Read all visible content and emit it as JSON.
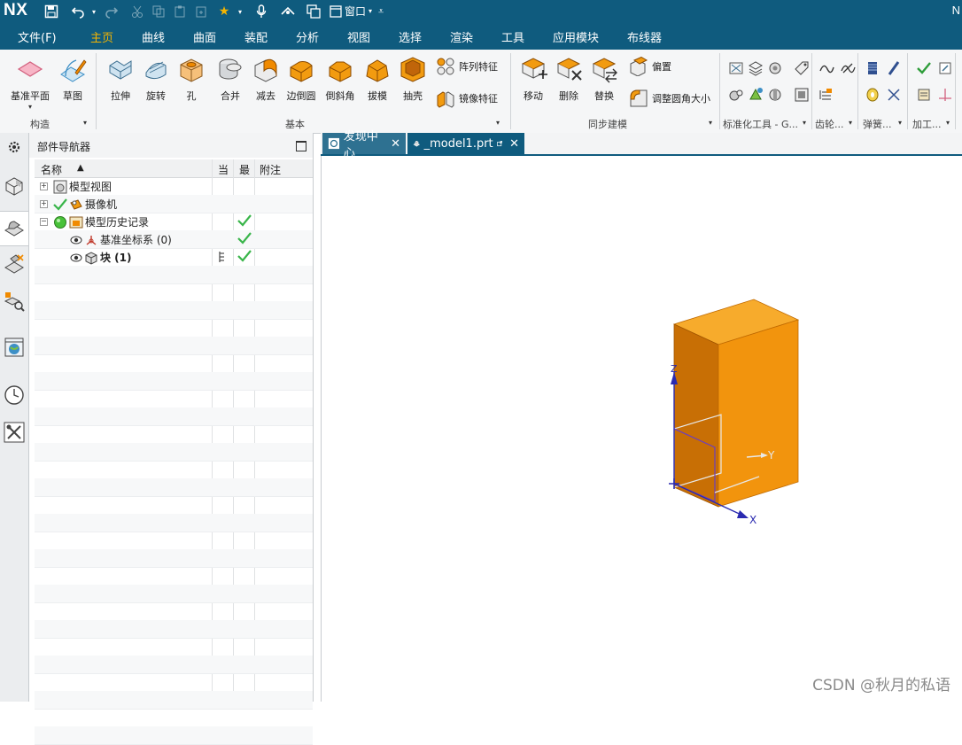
{
  "app": {
    "logo": "NX",
    "title_right": "N",
    "window_label": "窗口"
  },
  "menu": [
    {
      "label": "文件(F)",
      "active": false
    },
    {
      "label": "主页",
      "active": true
    },
    {
      "label": "曲线",
      "active": false
    },
    {
      "label": "曲面",
      "active": false
    },
    {
      "label": "装配",
      "active": false
    },
    {
      "label": "分析",
      "active": false
    },
    {
      "label": "视图",
      "active": false
    },
    {
      "label": "选择",
      "active": false
    },
    {
      "label": "渲染",
      "active": false
    },
    {
      "label": "工具",
      "active": false
    },
    {
      "label": "应用模块",
      "active": false
    },
    {
      "label": "布线器",
      "active": false
    }
  ],
  "ribbon": {
    "construct": {
      "label": "构造",
      "buttons": [
        "基准平面",
        "草图"
      ]
    },
    "basic": {
      "label": "基本",
      "buttons": [
        "拉伸",
        "旋转",
        "孔",
        "合并",
        "减去",
        "边倒圆",
        "倒斜角",
        "拔模",
        "抽壳"
      ],
      "small": [
        "阵列特征",
        "镜像特征"
      ]
    },
    "sync": {
      "label": "同步建模",
      "buttons": [
        "移动",
        "删除",
        "替换"
      ],
      "small": [
        "偏置",
        "调整圆角大小"
      ]
    },
    "more_groups": [
      "标准化工具 - G...",
      "齿轮...",
      "弹簧...",
      "加工..."
    ],
    "accent": "#f08a00"
  },
  "navigator": {
    "title": "部件导航器",
    "columns": {
      "name": "名称",
      "current": "当",
      "latest": "最",
      "notes": "附注"
    },
    "rows": [
      {
        "label": "模型视图",
        "bold": false
      },
      {
        "label": "摄像机",
        "bold": false
      },
      {
        "label": "模型历史记录",
        "bold": false
      },
      {
        "label": "基准坐标系 (0)",
        "bold": false
      },
      {
        "label": "块 (1)",
        "bold": true
      }
    ]
  },
  "tabs": [
    {
      "label": "发现中心",
      "active": false
    },
    {
      "label": "_model1.prt",
      "active": true
    }
  ],
  "viewport": {
    "axes": {
      "x": "X",
      "y": "Y",
      "z": "Z"
    },
    "body_color": "#f29b10"
  },
  "watermark": "CSDN @秋月的私语"
}
